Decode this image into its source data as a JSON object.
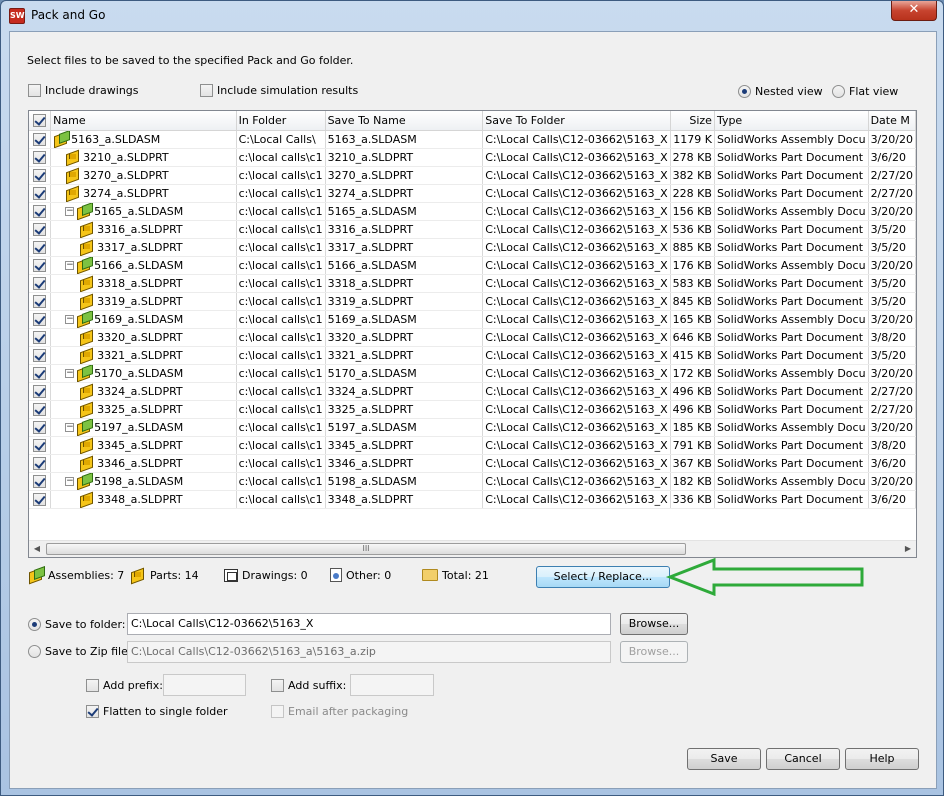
{
  "window": {
    "title": "Pack and Go",
    "close_label": "✕"
  },
  "instruction": "Select files to be saved to the specified Pack and Go folder.",
  "options": {
    "include_drawings": {
      "label": "Include drawings",
      "checked": false
    },
    "include_simulation": {
      "label": "Include simulation results",
      "checked": false
    },
    "nested_view": {
      "label": "Nested view",
      "selected": true
    },
    "flat_view": {
      "label": "Flat view",
      "selected": false
    }
  },
  "grid": {
    "columns": [
      "Name",
      "In Folder",
      "Save To Name",
      "Save To Folder",
      "Size",
      "Type",
      "Date M"
    ],
    "rows": [
      {
        "name": "5163_a.SLDASM",
        "kind": "asm",
        "level": 0,
        "toggle": "",
        "in_folder": "C:\\Local Calls\\",
        "save_name": "5163_a.SLDASM",
        "save_folder": "C:\\Local Calls\\C12-03662\\5163_X",
        "size": "1179 K",
        "type": "SolidWorks Assembly Docu",
        "date": "3/20/20"
      },
      {
        "name": "3210_a.SLDPRT",
        "kind": "prt",
        "level": 1,
        "toggle": "",
        "in_folder": "c:\\local calls\\c1",
        "save_name": "3210_a.SLDPRT",
        "save_folder": "C:\\Local Calls\\C12-03662\\5163_X",
        "size": "278 KB",
        "type": "SolidWorks Part Document",
        "date": "3/6/20"
      },
      {
        "name": "3270_a.SLDPRT",
        "kind": "prt",
        "level": 1,
        "toggle": "",
        "in_folder": "c:\\local calls\\c1",
        "save_name": "3270_a.SLDPRT",
        "save_folder": "C:\\Local Calls\\C12-03662\\5163_X",
        "size": "382 KB",
        "type": "SolidWorks Part Document",
        "date": "2/27/20"
      },
      {
        "name": "3274_a.SLDPRT",
        "kind": "prt",
        "level": 1,
        "toggle": "",
        "in_folder": "c:\\local calls\\c1",
        "save_name": "3274_a.SLDPRT",
        "save_folder": "C:\\Local Calls\\C12-03662\\5163_X",
        "size": "228 KB",
        "type": "SolidWorks Part Document",
        "date": "2/27/20"
      },
      {
        "name": "5165_a.SLDASM",
        "kind": "asm",
        "level": 1,
        "toggle": "−",
        "in_folder": "c:\\local calls\\c1",
        "save_name": "5165_a.SLDASM",
        "save_folder": "C:\\Local Calls\\C12-03662\\5163_X",
        "size": "156 KB",
        "type": "SolidWorks Assembly Docu",
        "date": "3/20/20"
      },
      {
        "name": "3316_a.SLDPRT",
        "kind": "prt",
        "level": 2,
        "toggle": "",
        "in_folder": "c:\\local calls\\c1",
        "save_name": "3316_a.SLDPRT",
        "save_folder": "C:\\Local Calls\\C12-03662\\5163_X",
        "size": "536 KB",
        "type": "SolidWorks Part Document",
        "date": "3/5/20"
      },
      {
        "name": "3317_a.SLDPRT",
        "kind": "prt",
        "level": 2,
        "toggle": "",
        "in_folder": "c:\\local calls\\c1",
        "save_name": "3317_a.SLDPRT",
        "save_folder": "C:\\Local Calls\\C12-03662\\5163_X",
        "size": "885 KB",
        "type": "SolidWorks Part Document",
        "date": "3/5/20"
      },
      {
        "name": "5166_a.SLDASM",
        "kind": "asm",
        "level": 1,
        "toggle": "−",
        "in_folder": "c:\\local calls\\c1",
        "save_name": "5166_a.SLDASM",
        "save_folder": "C:\\Local Calls\\C12-03662\\5163_X",
        "size": "176 KB",
        "type": "SolidWorks Assembly Docu",
        "date": "3/20/20"
      },
      {
        "name": "3318_a.SLDPRT",
        "kind": "prt",
        "level": 2,
        "toggle": "",
        "in_folder": "c:\\local calls\\c1",
        "save_name": "3318_a.SLDPRT",
        "save_folder": "C:\\Local Calls\\C12-03662\\5163_X",
        "size": "583 KB",
        "type": "SolidWorks Part Document",
        "date": "3/5/20"
      },
      {
        "name": "3319_a.SLDPRT",
        "kind": "prt",
        "level": 2,
        "toggle": "",
        "in_folder": "c:\\local calls\\c1",
        "save_name": "3319_a.SLDPRT",
        "save_folder": "C:\\Local Calls\\C12-03662\\5163_X",
        "size": "845 KB",
        "type": "SolidWorks Part Document",
        "date": "3/5/20"
      },
      {
        "name": "5169_a.SLDASM",
        "kind": "asm",
        "level": 1,
        "toggle": "−",
        "in_folder": "c:\\local calls\\c1",
        "save_name": "5169_a.SLDASM",
        "save_folder": "C:\\Local Calls\\C12-03662\\5163_X",
        "size": "165 KB",
        "type": "SolidWorks Assembly Docu",
        "date": "3/20/20"
      },
      {
        "name": "3320_a.SLDPRT",
        "kind": "prt",
        "level": 2,
        "toggle": "",
        "in_folder": "c:\\local calls\\c1",
        "save_name": "3320_a.SLDPRT",
        "save_folder": "C:\\Local Calls\\C12-03662\\5163_X",
        "size": "646 KB",
        "type": "SolidWorks Part Document",
        "date": "3/8/20"
      },
      {
        "name": "3321_a.SLDPRT",
        "kind": "prt",
        "level": 2,
        "toggle": "",
        "in_folder": "c:\\local calls\\c1",
        "save_name": "3321_a.SLDPRT",
        "save_folder": "C:\\Local Calls\\C12-03662\\5163_X",
        "size": "415 KB",
        "type": "SolidWorks Part Document",
        "date": "3/5/20"
      },
      {
        "name": "5170_a.SLDASM",
        "kind": "asm",
        "level": 1,
        "toggle": "−",
        "in_folder": "c:\\local calls\\c1",
        "save_name": "5170_a.SLDASM",
        "save_folder": "C:\\Local Calls\\C12-03662\\5163_X",
        "size": "172 KB",
        "type": "SolidWorks Assembly Docu",
        "date": "3/20/20"
      },
      {
        "name": "3324_a.SLDPRT",
        "kind": "prt",
        "level": 2,
        "toggle": "",
        "in_folder": "c:\\local calls\\c1",
        "save_name": "3324_a.SLDPRT",
        "save_folder": "C:\\Local Calls\\C12-03662\\5163_X",
        "size": "496 KB",
        "type": "SolidWorks Part Document",
        "date": "2/27/20"
      },
      {
        "name": "3325_a.SLDPRT",
        "kind": "prt",
        "level": 2,
        "toggle": "",
        "in_folder": "c:\\local calls\\c1",
        "save_name": "3325_a.SLDPRT",
        "save_folder": "C:\\Local Calls\\C12-03662\\5163_X",
        "size": "496 KB",
        "type": "SolidWorks Part Document",
        "date": "2/27/20"
      },
      {
        "name": "5197_a.SLDASM",
        "kind": "asm",
        "level": 1,
        "toggle": "−",
        "in_folder": "c:\\local calls\\c1",
        "save_name": "5197_a.SLDASM",
        "save_folder": "C:\\Local Calls\\C12-03662\\5163_X",
        "size": "185 KB",
        "type": "SolidWorks Assembly Docu",
        "date": "3/20/20"
      },
      {
        "name": "3345_a.SLDPRT",
        "kind": "prt",
        "level": 2,
        "toggle": "",
        "in_folder": "c:\\local calls\\c1",
        "save_name": "3345_a.SLDPRT",
        "save_folder": "C:\\Local Calls\\C12-03662\\5163_X",
        "size": "791 KB",
        "type": "SolidWorks Part Document",
        "date": "3/8/20"
      },
      {
        "name": "3346_a.SLDPRT",
        "kind": "prt",
        "level": 2,
        "toggle": "",
        "in_folder": "c:\\local calls\\c1",
        "save_name": "3346_a.SLDPRT",
        "save_folder": "C:\\Local Calls\\C12-03662\\5163_X",
        "size": "367 KB",
        "type": "SolidWorks Part Document",
        "date": "3/6/20"
      },
      {
        "name": "5198_a.SLDASM",
        "kind": "asm",
        "level": 1,
        "toggle": "−",
        "in_folder": "c:\\local calls\\c1",
        "save_name": "5198_a.SLDASM",
        "save_folder": "C:\\Local Calls\\C12-03662\\5163_X",
        "size": "182 KB",
        "type": "SolidWorks Assembly Docu",
        "date": "3/20/20"
      },
      {
        "name": "3348_a.SLDPRT",
        "kind": "prt",
        "level": 2,
        "toggle": "",
        "in_folder": "c:\\local calls\\c1",
        "save_name": "3348_a.SLDPRT",
        "save_folder": "C:\\Local Calls\\C12-03662\\5163_X",
        "size": "336 KB",
        "type": "SolidWorks Part Document",
        "date": "3/6/20"
      }
    ],
    "scroll_grip": "III"
  },
  "summary": {
    "assemblies": "Assemblies: 7",
    "parts": "Parts: 14",
    "drawings": "Drawings: 0",
    "other": "Other: 0",
    "total": "Total: 21"
  },
  "select_replace_label": "Select / Replace...",
  "annotation_arrow_color": "#2eaa3a",
  "save_to_folder": {
    "label": "Save to folder:",
    "selected": true,
    "value": "C:\\Local Calls\\C12-03662\\5163_X",
    "browse": "Browse..."
  },
  "save_to_zip": {
    "label": "Save to Zip file:",
    "selected": false,
    "value": "C:\\Local Calls\\C12-03662\\5163_a\\5163_a.zip",
    "browse": "Browse..."
  },
  "add_prefix": {
    "label": "Add prefix:",
    "checked": false,
    "value": ""
  },
  "add_suffix": {
    "label": "Add suffix:",
    "checked": false,
    "value": ""
  },
  "flatten": {
    "label": "Flatten to single folder",
    "checked": true
  },
  "email_after": {
    "label": "Email after packaging",
    "checked": false
  },
  "buttons": {
    "save": "Save",
    "cancel": "Cancel",
    "help": "Help"
  },
  "header_checkbox_checked": true
}
